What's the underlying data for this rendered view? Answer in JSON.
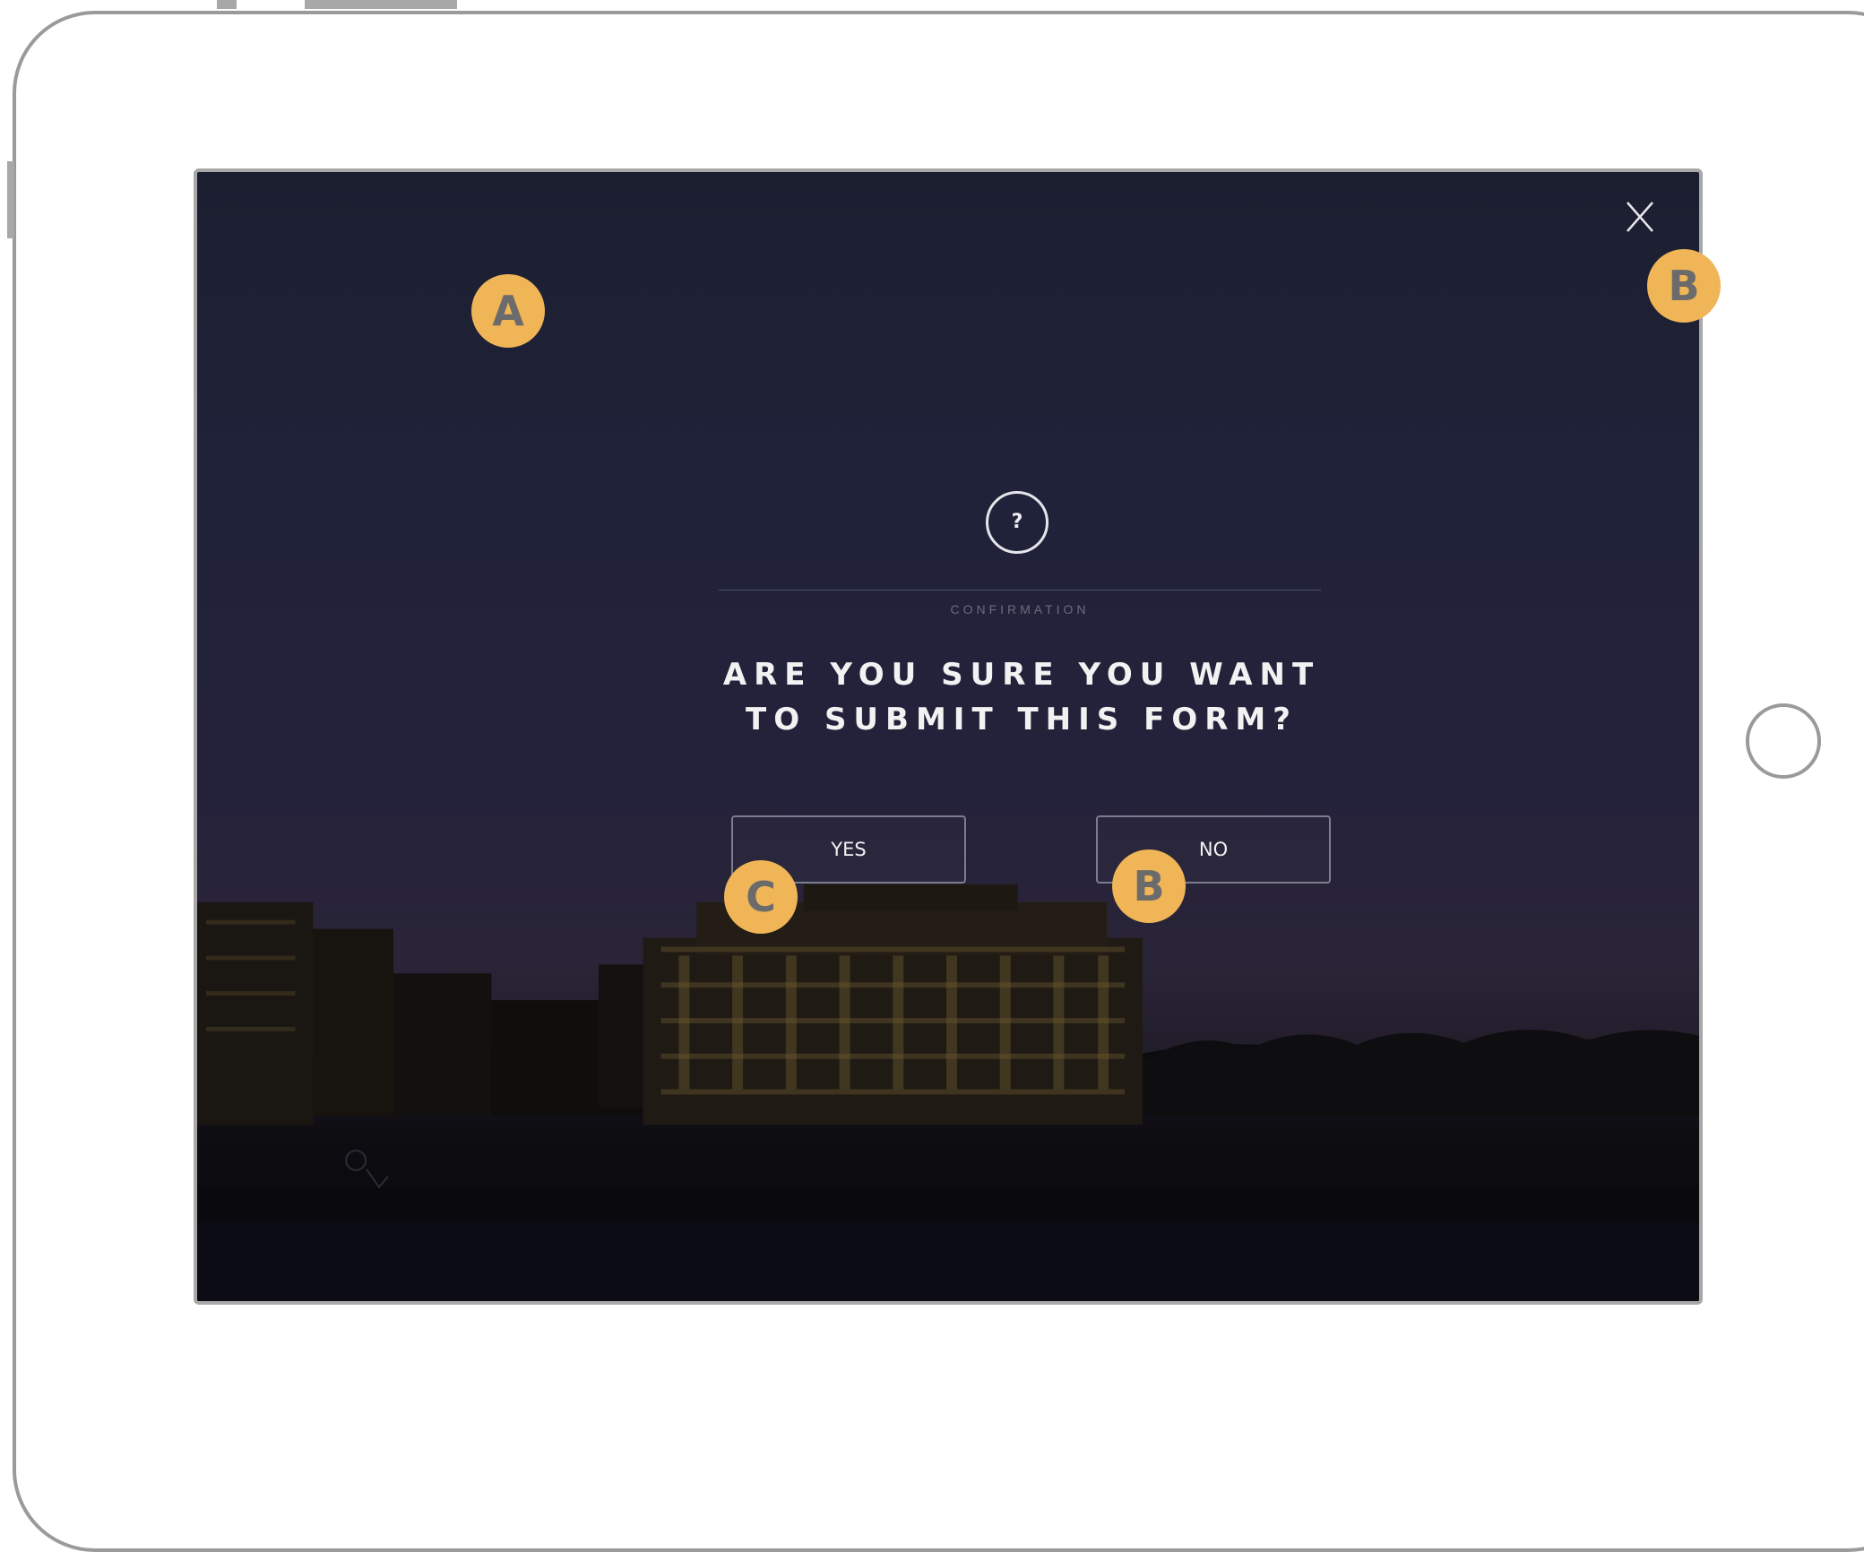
{
  "dialog": {
    "icon": "question-mark-icon",
    "icon_glyph": "?",
    "kicker": "CONFIRMATION",
    "headline_line1": "ARE YOU SURE YOU WANT",
    "headline_line2": "TO SUBMIT THIS FORM?",
    "yes_label": "YES",
    "no_label": "NO",
    "close_icon": "close-icon"
  },
  "annotations": {
    "marker_a": "A",
    "marker_b_close": "B",
    "marker_c_yes": "C",
    "marker_b_no": "B"
  },
  "colors": {
    "marker": "#f0b556",
    "marker_text": "#6b6b6b",
    "frame": "#9a9a9a"
  }
}
